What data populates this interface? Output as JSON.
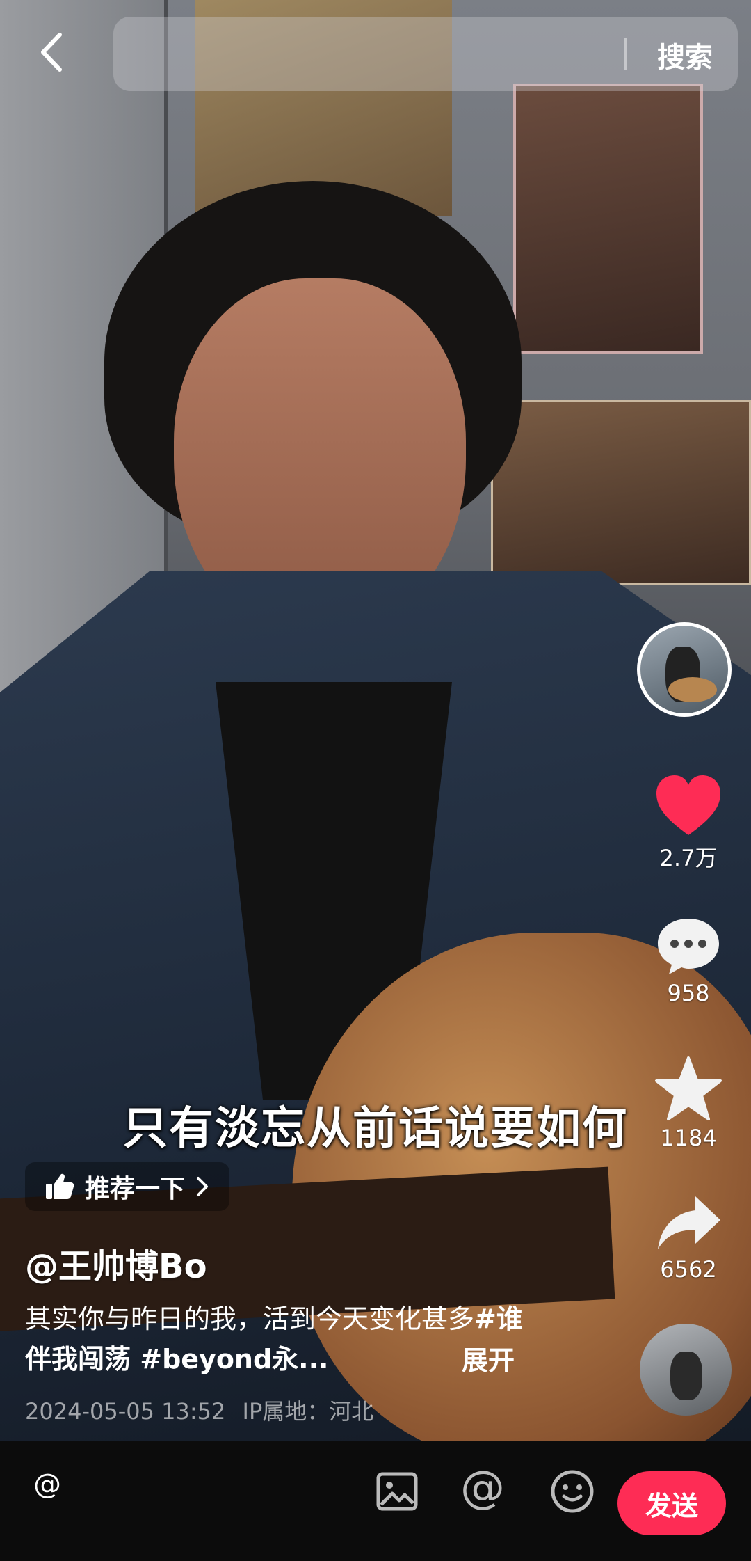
{
  "header": {
    "back_icon": "chevron-left-icon",
    "search_placeholder": "",
    "search_label": "搜索"
  },
  "actions": {
    "like_count": "2.7万",
    "comment_count": "958",
    "favorite_count": "1184",
    "share_count": "6562",
    "like_color": "#fe2c55"
  },
  "video": {
    "subtitle": "只有淡忘从前话说要如何"
  },
  "info": {
    "recommend_label": "推荐一下",
    "username": "@王帅博Bo",
    "desc_text": "其实你与昨日的我，活到今天变化甚多",
    "desc_tags": "#谁伴我闯荡 #beyond永...",
    "expand_label": "展开",
    "datetime": "2024-05-05 13:52",
    "ip_location": "IP属地：河北"
  },
  "composer": {
    "input_prefix": "@",
    "at_icon_label": "@",
    "send_label": "发送",
    "send_color": "#fe2c55"
  }
}
